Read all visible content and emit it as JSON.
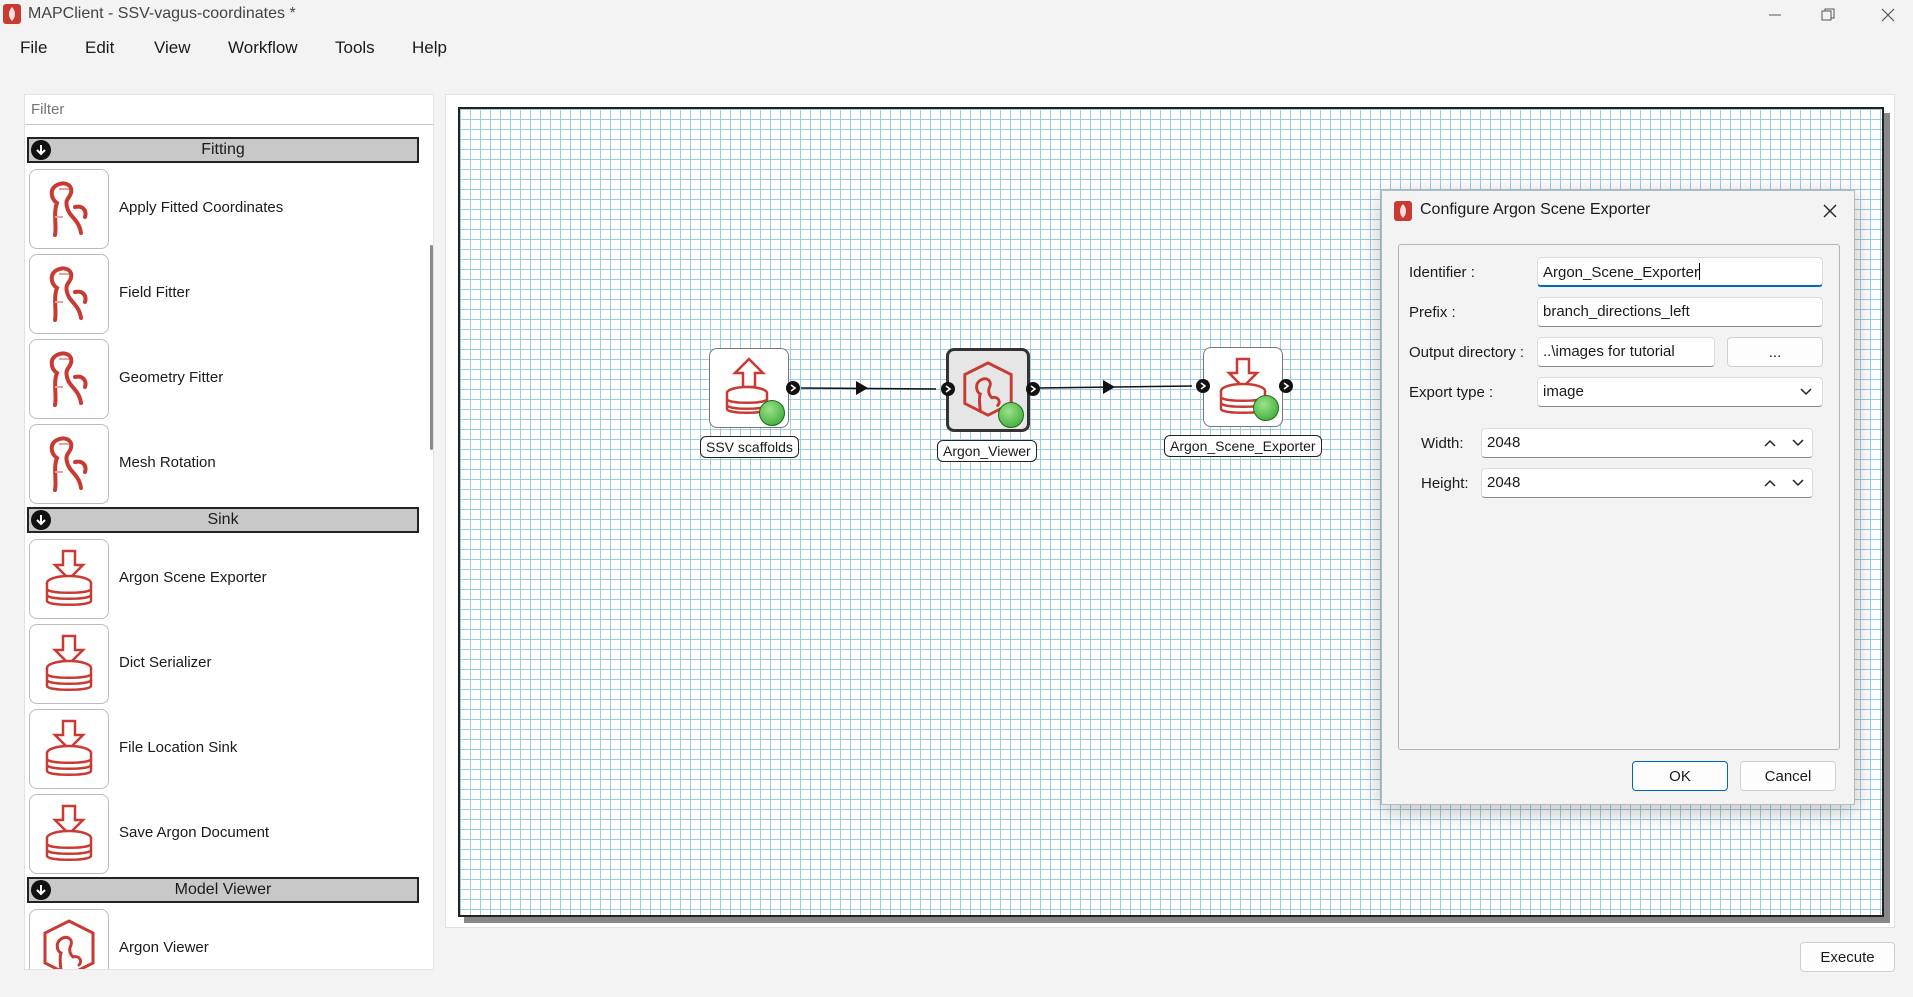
{
  "window": {
    "title": "MAPClient - SSV-vagus-coordinates *",
    "icon": "mapclient-logo-icon",
    "controls": [
      "minimize-icon",
      "restore-icon",
      "close-icon"
    ]
  },
  "menu": [
    "File",
    "Edit",
    "View",
    "Workflow",
    "Tools",
    "Help"
  ],
  "step_panel": {
    "filter_placeholder": "Filter",
    "categories": [
      {
        "name": "Fitting",
        "items": [
          "Apply Fitted Coordinates",
          "Field Fitter",
          "Geometry Fitter",
          "Mesh Rotation"
        ]
      },
      {
        "name": "Sink",
        "items": [
          "Argon Scene Exporter",
          "Dict Serializer",
          "File Location Sink",
          "Save Argon Document"
        ]
      },
      {
        "name": "Model Viewer",
        "items": [
          "Argon Viewer"
        ]
      }
    ]
  },
  "workflow": {
    "nodes": [
      {
        "label": "SSV scaffolds",
        "icon": "source-database-icon"
      },
      {
        "label": "Argon_Viewer",
        "icon": "argon-viewer-icon"
      },
      {
        "label": "Argon_Scene_Exporter",
        "icon": "sink-database-icon"
      }
    ]
  },
  "dialog": {
    "title": "Configure Argon Scene Exporter",
    "identifier_label": "Identifier :",
    "identifier_value": "Argon_Scene_Exporter",
    "prefix_label": "Prefix :",
    "prefix_value": "branch_directions_left",
    "output_dir_label": "Output directory :",
    "output_dir_value": "..\\images for tutorial",
    "browse_label": "...",
    "export_type_label": "Export type :",
    "export_type_value": "image",
    "width_label": "Width:",
    "width_value": "2048",
    "height_label": "Height:",
    "height_value": "2048",
    "ok_label": "OK",
    "cancel_label": "Cancel"
  },
  "execute_label": "Execute",
  "colors": {
    "accent": "#0067c0",
    "icon_red": "#c83a32",
    "grid_line": "#9ecde0",
    "category_header": "#c8c8c8"
  }
}
